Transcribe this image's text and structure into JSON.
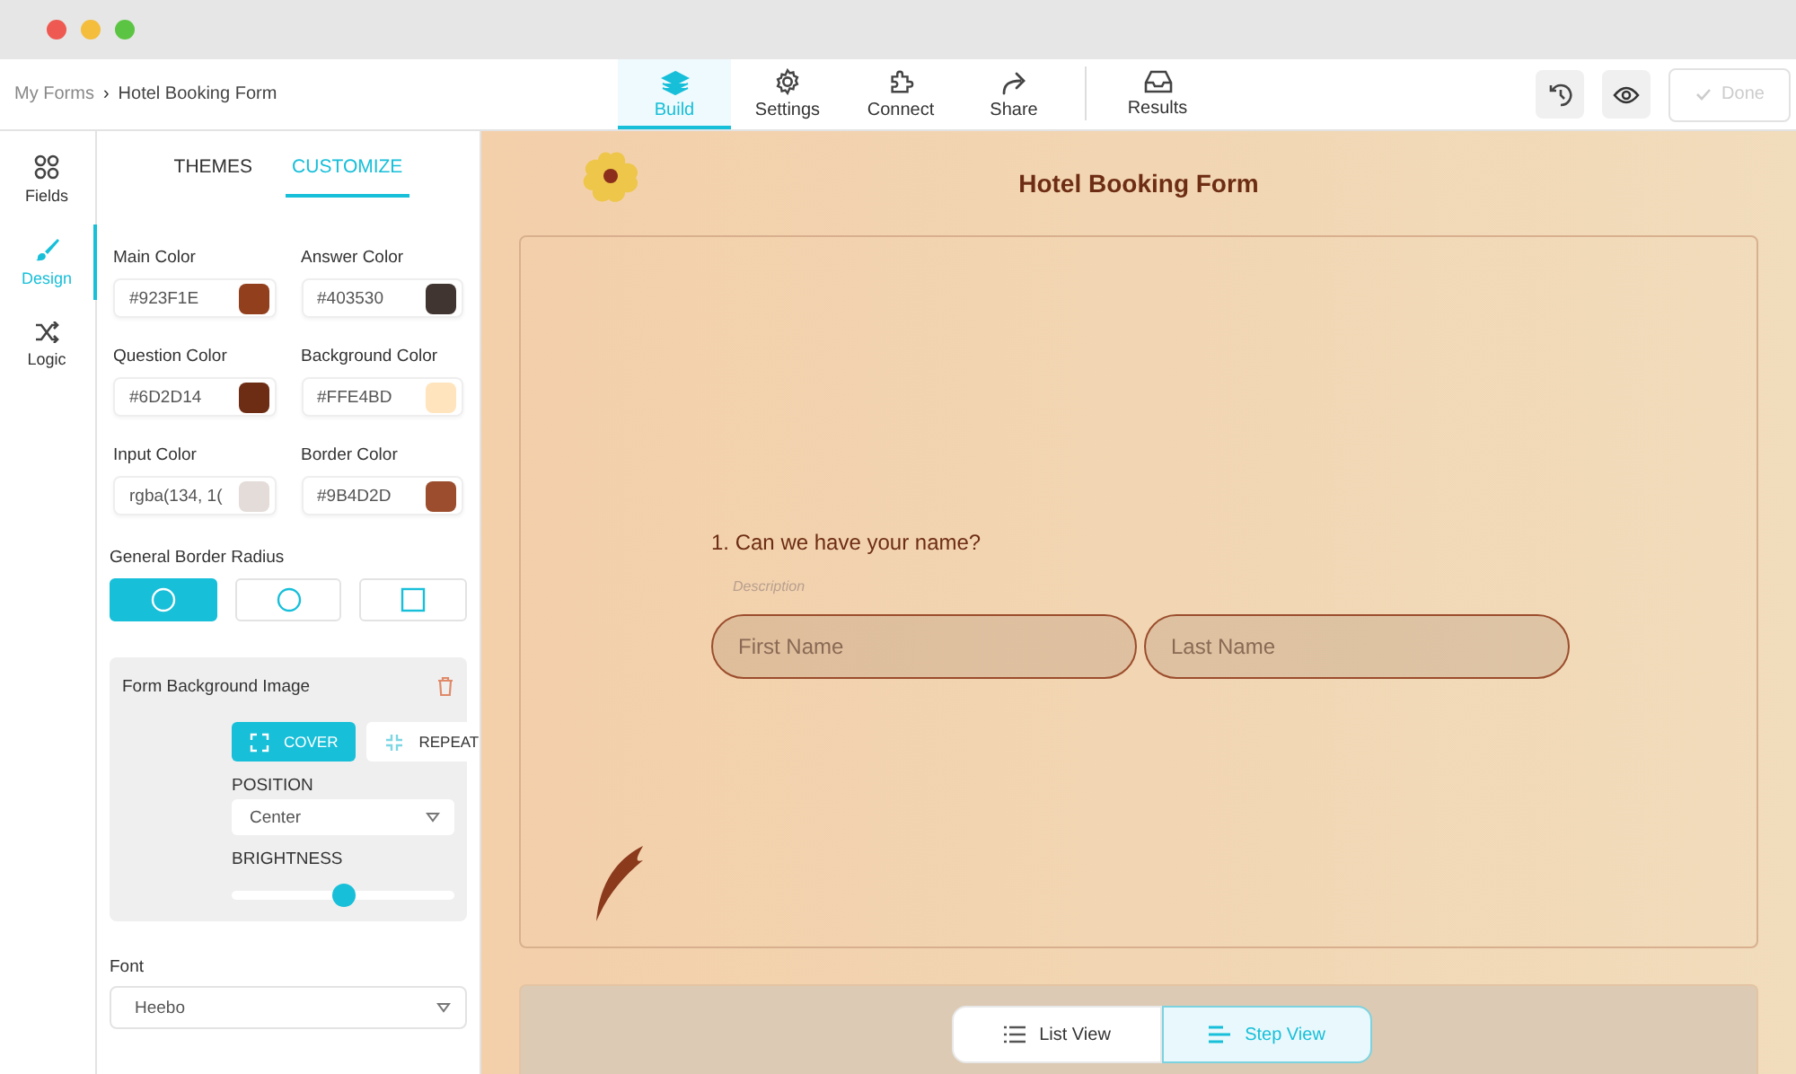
{
  "breadcrumb": {
    "parent": "My Forms",
    "separator": "›",
    "current": "Hotel Booking Form"
  },
  "nav_tabs": [
    {
      "label": "Build",
      "kind": "layers",
      "selected": true
    },
    {
      "label": "Settings",
      "kind": "gear",
      "selected": false
    },
    {
      "label": "Connect",
      "kind": "puzzle",
      "selected": false
    },
    {
      "label": "Share",
      "kind": "share",
      "selected": false
    },
    {
      "label": "Results",
      "kind": "inbox",
      "selected": false
    }
  ],
  "done_button": {
    "label": "Done",
    "disabled": true
  },
  "sidebar": {
    "items": [
      {
        "label": "Fields",
        "kind": "grid",
        "selected": false
      },
      {
        "label": "Design",
        "kind": "brush",
        "selected": true
      },
      {
        "label": "Logic",
        "kind": "shuffle",
        "selected": false
      }
    ]
  },
  "panel_tabs": [
    {
      "label": "THEMES",
      "selected": false
    },
    {
      "label": "CUSTOMIZE",
      "selected": true
    }
  ],
  "colors": [
    {
      "label": "Main Color",
      "value": "#923F1E",
      "color": "#923f1e"
    },
    {
      "label": "Answer Color",
      "value": "#403530",
      "color": "#403530"
    },
    {
      "label": "Question Color",
      "value": "#6D2D14",
      "color": "#6d2d14"
    },
    {
      "label": "Background Color",
      "value": "#FFE4BD",
      "color": "#ffe4bd"
    },
    {
      "label": "Input Color",
      "value": "rgba(134, 1(",
      "color": "#e3dcd8"
    },
    {
      "label": "Border Color",
      "value": "#9B4D2D",
      "color": "#9b4d2d"
    }
  ],
  "border_radius": {
    "label": "General Border Radius",
    "options": [
      {
        "kind": "circle",
        "selected": true
      },
      {
        "kind": "circle",
        "selected": false
      },
      {
        "kind": "square",
        "selected": false
      }
    ]
  },
  "background_image": {
    "title": "Form Background Image",
    "modes": [
      {
        "label": "COVER",
        "kind": "cover",
        "selected": true
      },
      {
        "label": "REPEAT",
        "kind": "repeat",
        "selected": false
      }
    ],
    "position_label": "POSITION",
    "position_value": "Center",
    "brightness_label": "BRIGHTNESS",
    "brightness": {
      "level": 0.5
    }
  },
  "font": {
    "label": "Font",
    "value": "Heebo"
  },
  "form": {
    "title": "Hotel Booking Form",
    "question": "1. Can we have your name?",
    "description": "Description",
    "inputs": [
      {
        "placeholder": "First Name"
      },
      {
        "placeholder": "Last Name"
      }
    ]
  },
  "view_toggle": [
    {
      "label": "List View",
      "kind": "list",
      "selected": false
    },
    {
      "label": "Step View",
      "kind": "step",
      "selected": true
    }
  ]
}
